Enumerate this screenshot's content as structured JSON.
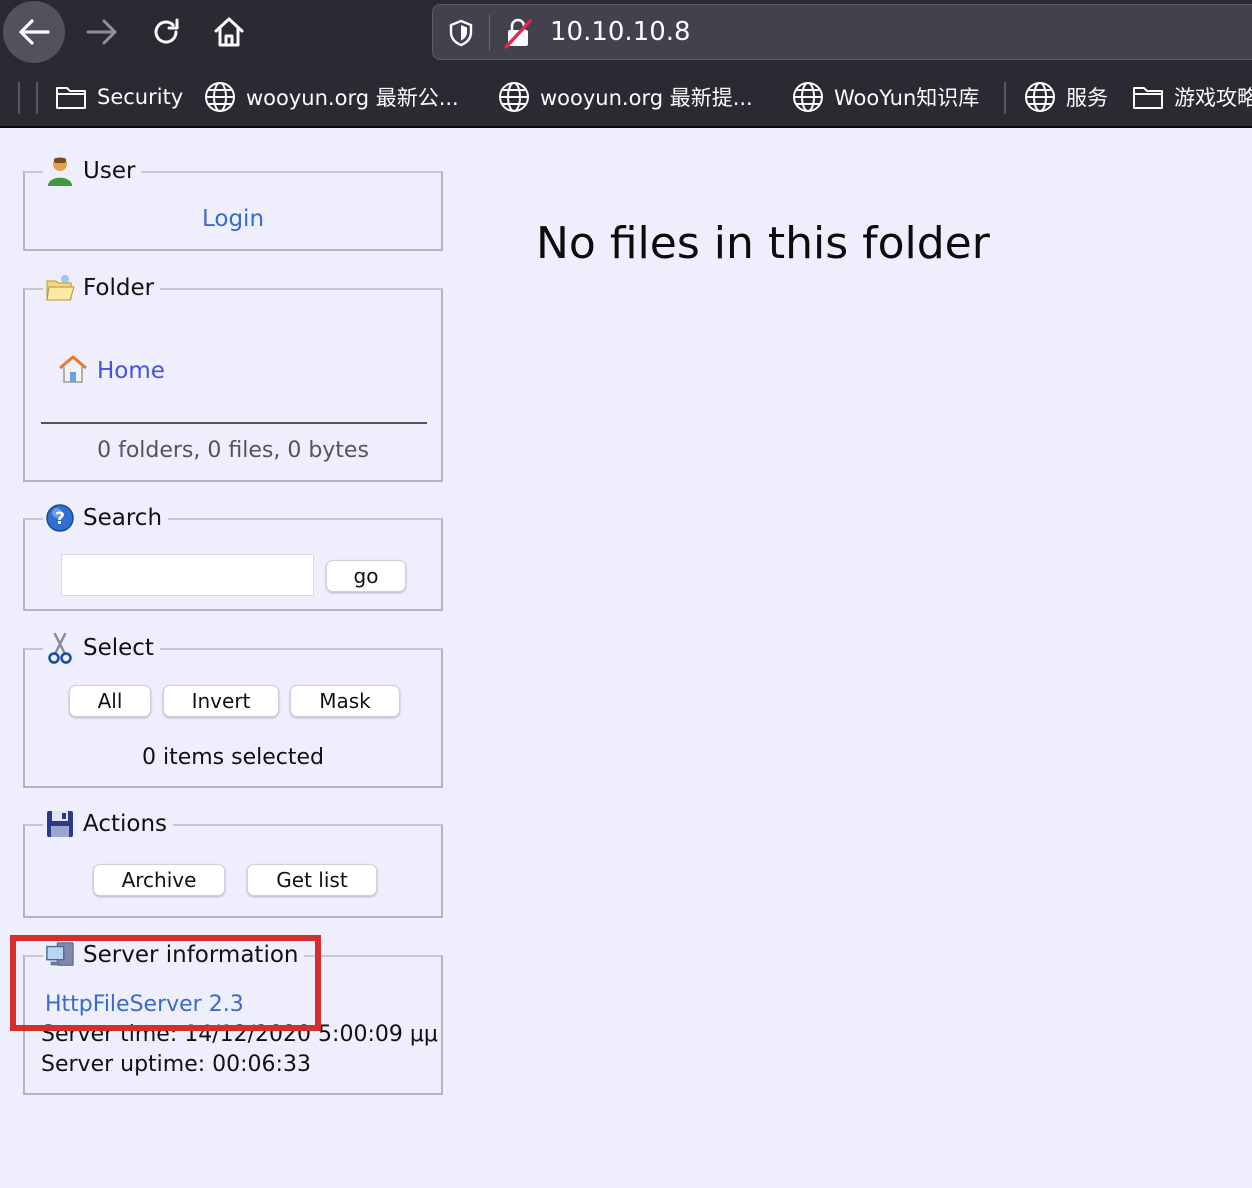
{
  "browser": {
    "url": "10.10.10.8",
    "bookmarks": [
      {
        "label": "Security",
        "icon": "folder-icon"
      },
      {
        "label": "wooyun.org 最新公...",
        "icon": "globe-icon"
      },
      {
        "label": "wooyun.org 最新提...",
        "icon": "globe-icon"
      },
      {
        "label": "WooYun知识库",
        "icon": "globe-icon"
      },
      {
        "label": "服务",
        "icon": "globe-icon"
      },
      {
        "label": "游戏攻略",
        "icon": "folder-icon"
      }
    ]
  },
  "user": {
    "title": "User",
    "login": "Login"
  },
  "folder": {
    "title": "Folder",
    "home": "Home",
    "stats": "0 folders, 0 files, 0 bytes"
  },
  "search": {
    "title": "Search",
    "query": "",
    "go": "go"
  },
  "select": {
    "title": "Select",
    "all": "All",
    "invert": "Invert",
    "mask": "Mask",
    "status": "0 items selected"
  },
  "actions": {
    "title": "Actions",
    "archive": "Archive",
    "get_list": "Get list"
  },
  "server": {
    "title": "Server information",
    "version_link": "HttpFileServer 2.3",
    "time": "Server time: 14/12/2020 5:00:09 μμ",
    "uptime": "Server uptime: 00:06:33"
  },
  "main": {
    "message": "No files in this folder"
  },
  "colors": {
    "page_bg": "#eeeefd",
    "link": "#3a6bc9",
    "highlight": "#d62d2d"
  }
}
